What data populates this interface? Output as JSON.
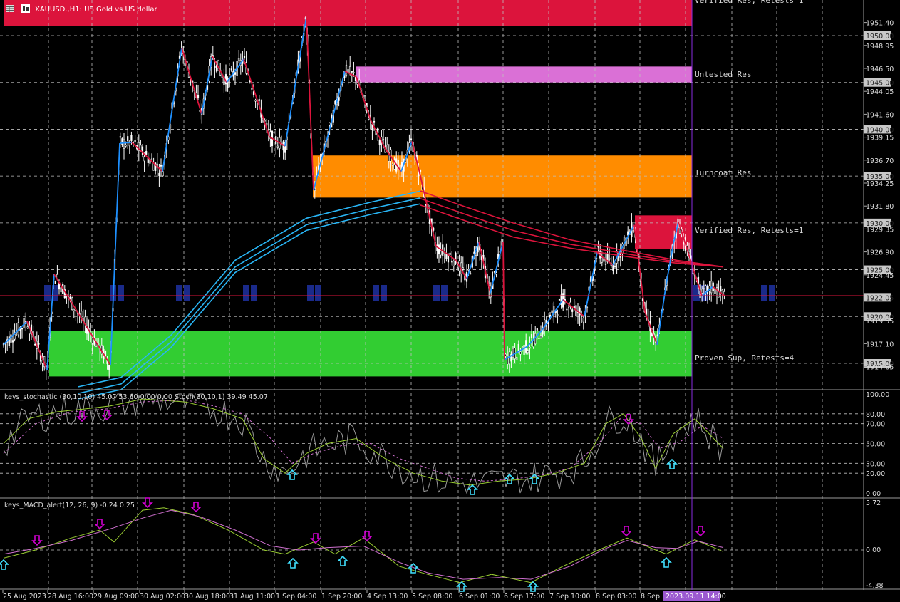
{
  "header": {
    "symbol": "XAUUSD.,H1: US Gold vs US dollar"
  },
  "main_chart": {
    "y_range": [
      1913.6,
      1953.5
    ],
    "current_price": "1922.05",
    "price_axis_labels": [
      "1951.40",
      "1950.00",
      "1948.95",
      "1946.50",
      "1945.00",
      "1944.05",
      "1941.60",
      "1940.00",
      "1939.15",
      "1936.70",
      "1935.00",
      "1934.25",
      "1931.80",
      "1930.00",
      "1929.35",
      "1926.90",
      "1925.00",
      "1924.45",
      "1922.05",
      "1920.00",
      "1919.55",
      "1917.10",
      "1915.00",
      "1914.65"
    ],
    "boxed_levels": [
      "1950.00",
      "1945.00",
      "1940.00",
      "1935.00",
      "1930.00",
      "1925.00",
      "1922.05",
      "1920.00",
      "1915.00"
    ],
    "zones": [
      {
        "label": "Verified Res, Retests=1",
        "top": 1953.5,
        "bottom": 1951.0,
        "color": "#dc143c"
      },
      {
        "label": "Untested Res",
        "top": 1946.7,
        "bottom": 1945.0,
        "color": "#da70d6"
      },
      {
        "label": "Turncoat Res",
        "top": 1937.2,
        "bottom": 1932.7,
        "color": "#ff8c00"
      },
      {
        "label": "Verified Res, Retests=1",
        "top": 1930.8,
        "bottom": 1927.2,
        "color": "#dc143c"
      },
      {
        "label": "Proven Sup, Retests=4",
        "top": 1918.5,
        "bottom": 1913.6,
        "color": "#32cd32"
      }
    ]
  },
  "stochastic": {
    "title": "keys_stochastic (30,10,10) 45.07 53.60 0.00 0.00 Stoch(30,10,1) 39.49 45.07",
    "axis_labels": [
      "100.00",
      "80.00",
      "70.00",
      "50.00",
      "30.00",
      "20.00",
      "0.00"
    ]
  },
  "macd": {
    "title": "keys_MACD_alert(12, 26, 9) -0.24 0.25",
    "axis_labels": [
      "5.72",
      "0.00",
      "-4.38"
    ]
  },
  "time_axis": {
    "labels": [
      "25 Aug 2023",
      "28 Aug 16:00",
      "29 Aug 09:00",
      "30 Aug 02:00",
      "30 Aug 18:00",
      "31 Aug 11:00",
      "1 Sep 04:00",
      "1 Sep 20:00",
      "4 Sep 13:00",
      "5 Sep 08:00",
      "6 Sep 01:00",
      "6 Sep 17:00",
      "7 Sep 10:00",
      "8 Sep 03:00",
      "8 Sep 1"
    ],
    "cursor_label": "2023.09.11 14:00"
  },
  "colors": {
    "background": "#000000",
    "grid": "#c0c0c0",
    "candles": "#ffffff",
    "zigzag_up": "#1e90ff",
    "zigzag_down": "#dc143c",
    "ma_blue": "#29b6f6",
    "ma_red": "#dc143c",
    "current_line": "#dc143c",
    "cursor_line": "#8a2be2"
  }
}
